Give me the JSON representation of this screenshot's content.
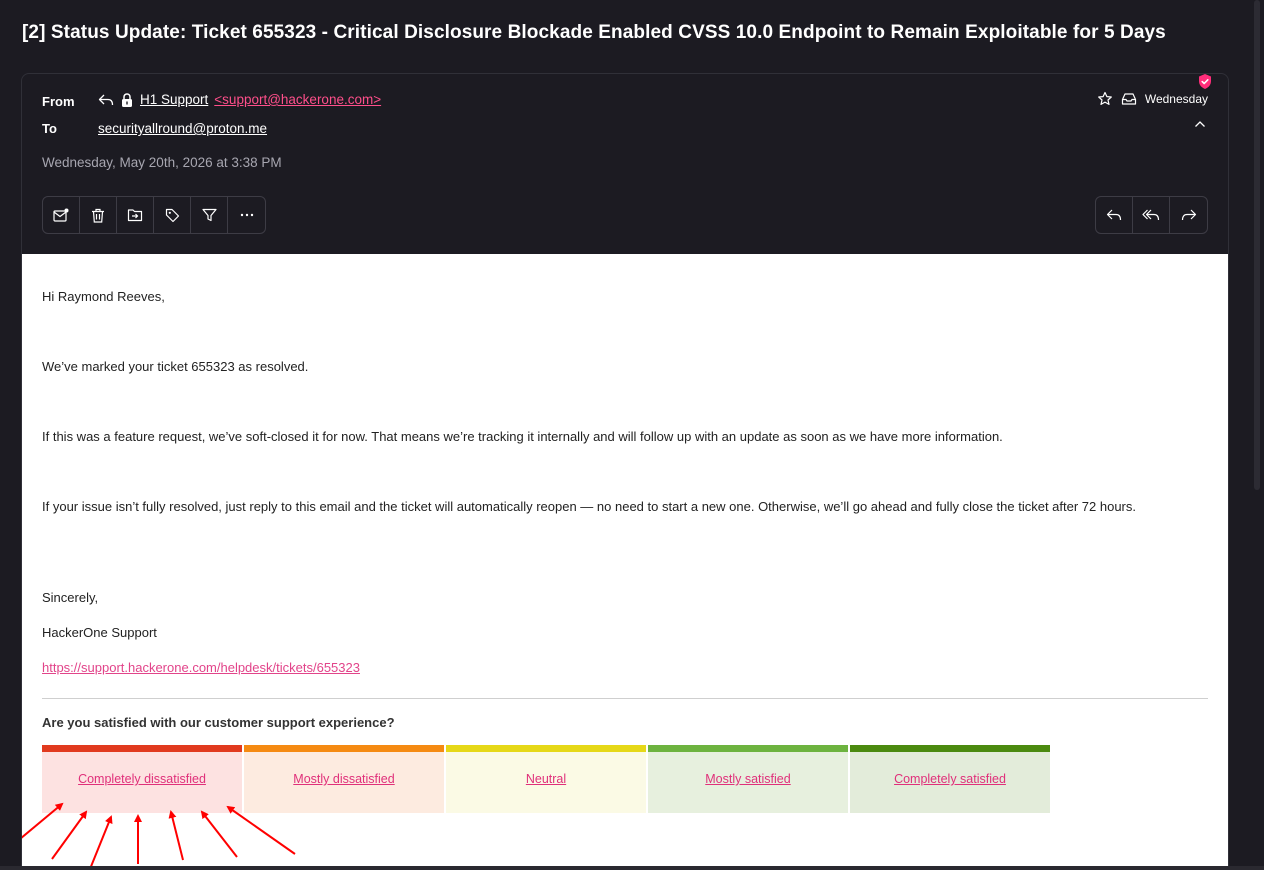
{
  "subject": "[2] Status Update: Ticket 655323 - Critical Disclosure Blockade Enabled CVSS 10.0 Endpoint to Remain Exploitable for 5 Days",
  "header": {
    "from_label": "From",
    "to_label": "To",
    "sender_name": "H1 Support",
    "sender_address": "<support@hackerone.com>",
    "recipient": "securityallround@proton.me",
    "date": "Wednesday, May 20th, 2026 at 3:38 PM",
    "day": "Wednesday"
  },
  "toolbar_left": [
    "mark-unread-icon",
    "trash-icon",
    "move-to-folder-icon",
    "label-tag-icon",
    "filter-icon",
    "more-icon"
  ],
  "toolbar_right": [
    "reply-icon",
    "reply-all-icon",
    "forward-icon"
  ],
  "body": {
    "greeting": "Hi Raymond Reeves,",
    "p1": "We’ve marked your ticket 655323 as resolved.",
    "p2": "If this was a feature request, we’ve soft-closed it for now. That means we’re tracking it internally and will follow up with an update as soon as we have more information.",
    "p3": "If your issue isn’t fully resolved, just reply to this email and the ticket will automatically reopen — no need to start a new one. Otherwise, we’ll go ahead and fully close the ticket after 72 hours.",
    "signoff": "Sincerely,",
    "signature": "HackerOne Support",
    "link": "https://support.hackerone.com/helpdesk/tickets/655323"
  },
  "survey": {
    "question": "Are you satisfied with our customer support experience?",
    "options": [
      "Completely dissatisfied",
      "Mostly dissatisfied",
      "Neutral",
      "Mostly satisfied",
      "Completely satisfied"
    ]
  },
  "colors": {
    "accent": "#ff4f8b",
    "link": "#e2448a",
    "background": "#1c1b22",
    "annotation_arrows": "#ff0000"
  }
}
